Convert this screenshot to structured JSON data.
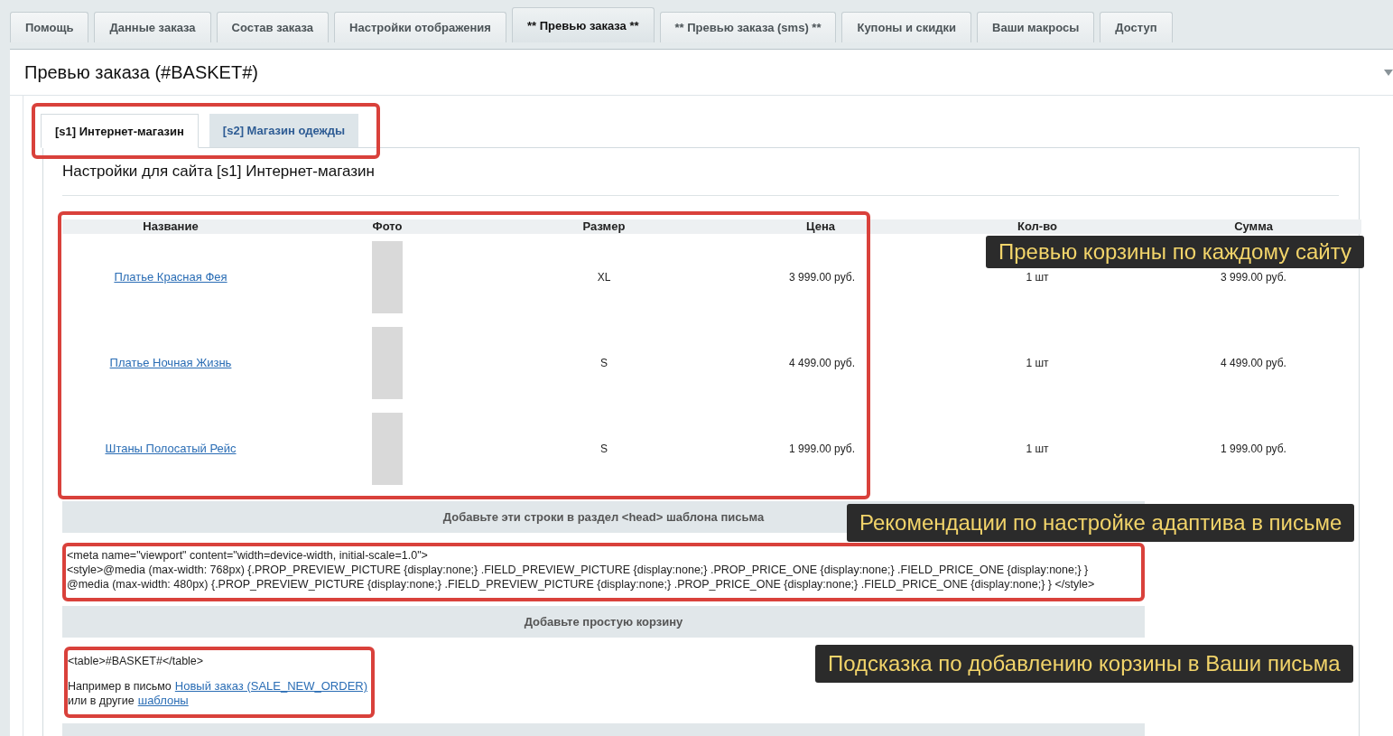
{
  "top_tabs": [
    {
      "label": "Помощь",
      "selected": false
    },
    {
      "label": "Данные заказа",
      "selected": false
    },
    {
      "label": "Состав заказа",
      "selected": false
    },
    {
      "label": "Настройки отображения",
      "selected": false
    },
    {
      "label": "** Превью заказа **",
      "selected": true
    },
    {
      "label": "** Превью заказа (sms) **",
      "selected": false
    },
    {
      "label": "Купоны и скидки",
      "selected": false
    },
    {
      "label": "Ваши макросы",
      "selected": false
    },
    {
      "label": "Доступ",
      "selected": false
    }
  ],
  "page_title": "Превью заказа (#BASKET#)",
  "site_tabs": [
    {
      "label": "[s1] Интернет-магазин",
      "selected": true
    },
    {
      "label": "[s2] Магазин одежды",
      "selected": false
    }
  ],
  "section_title": "Настройки для сайта [s1] Интернет-магазин",
  "basket_table": {
    "columns": [
      "Название",
      "Фото",
      "Размер",
      "Цена",
      "Кол-во",
      "Сумма"
    ],
    "rows": [
      {
        "name": "Платье Красная Фея",
        "size": "XL",
        "price": "3 999.00 руб.",
        "quantity": "1 шт",
        "sum": "3 999.00 руб."
      },
      {
        "name": "Платье Ночная Жизнь",
        "size": "S",
        "price": "4 499.00 руб.",
        "quantity": "1 шт",
        "sum": "4 499.00 руб."
      },
      {
        "name": "Штаны Полосатый Рейс",
        "size": "S",
        "price": "1 999.00 руб.",
        "quantity": "1 шт",
        "sum": "1 999.00 руб."
      }
    ]
  },
  "head_section": {
    "heading": "Добавьте эти строки в раздел <head> шаблона письма",
    "code_lines": [
      "<meta name=\"viewport\" content=\"width=device-width, initial-scale=1.0\">",
      "<style>@media (max-width: 768px) {.PROP_PREVIEW_PICTURE {display:none;} .FIELD_PREVIEW_PICTURE {display:none;} .PROP_PRICE_ONE {display:none;} .FIELD_PRICE_ONE {display:none;} }",
      "@media (max-width: 480px) {.PROP_PREVIEW_PICTURE {display:none;} .FIELD_PREVIEW_PICTURE {display:none;} .PROP_PRICE_ONE {display:none;} .FIELD_PRICE_ONE {display:none;} } </style>"
    ]
  },
  "simple_basket": {
    "heading": "Добавьте простую корзину",
    "code": "<table>#BASKET#</table>",
    "example_text": "Например в письмо",
    "example_link": "Новый заказ (SALE_NEW_ORDER)",
    "other_text": "или в другие",
    "other_link": "шаблоны"
  },
  "annotations": [
    "Превью корзины по каждому сайту",
    "Рекомендации по настройке адаптива в письме",
    "Подсказка по добавлению корзины в Ваши письма"
  ]
}
